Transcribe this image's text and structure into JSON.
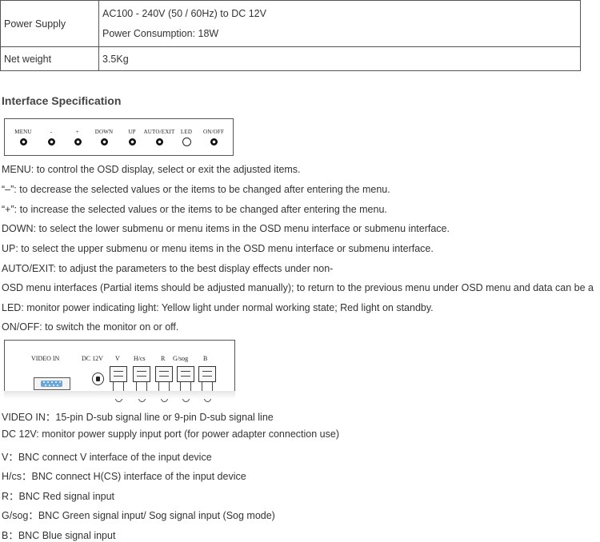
{
  "spec_table": {
    "power_supply_label": "Power Supply",
    "power_supply_line1": "AC100 - 240V (50 / 60Hz) to DC 12V",
    "power_supply_line2": "Power Consumption: 18W",
    "net_weight_label": "Net weight",
    "net_weight_value": "3.5Kg"
  },
  "section_heading": "Interface Specification",
  "front_panel": {
    "buttons": [
      {
        "label": "MENU",
        "icon": "filled-button"
      },
      {
        "label": "-",
        "icon": "filled-button"
      },
      {
        "label": "+",
        "icon": "filled-button"
      },
      {
        "label": "DOWN",
        "icon": "filled-button"
      },
      {
        "label": "UP",
        "icon": "filled-button"
      },
      {
        "label": "AUTO/EXIT",
        "icon": "filled-button"
      },
      {
        "label": "LED",
        "icon": "hollow-led"
      },
      {
        "label": "ON/OFF",
        "icon": "filled-button"
      }
    ]
  },
  "button_descriptions": [
    "MENU: to control the OSD display, select or exit the adjusted items.",
    "“–”: to decrease the selected values or the items to be changed after entering the menu.",
    "“+”: to increase the selected values or the items to be changed after entering the menu.",
    "DOWN: to select the lower submenu or menu items in the OSD menu interface or submenu interface.",
    "UP: to select the upper submenu or menu items in the OSD menu interface or submenu interface.",
    "AUTO/EXIT: to adjust the parameters to the best display effects under non-",
    "OSD menu interfaces (Partial items should be adjusted manually); to return to the previous menu under OSD menu and data can be a",
    "LED: monitor power indicating light: Yellow light under normal working state; Red light on standby.",
    "ON/OFF: to switch the monitor on or off."
  ],
  "rear_panel": {
    "labels": [
      "VIDEO IN",
      "DC 12V",
      "V",
      "H/cs",
      "R",
      "G/sog",
      "B"
    ],
    "vga_color": "#6aa6d8"
  },
  "port_descriptions": [
    "VIDEO IN：15-pin D-sub signal line or 9-pin D-sub signal line",
    "DC 12V: monitor power supply input port (for power adapter connection use)",
    "V：BNC connect V interface of the input device",
    "H/cs：BNC connect H(CS) interface of the input device",
    "R：BNC Red signal input",
    "G/sog：BNC Green signal input/ Sog signal input (Sog mode)",
    "B：BNC Blue signal input"
  ]
}
